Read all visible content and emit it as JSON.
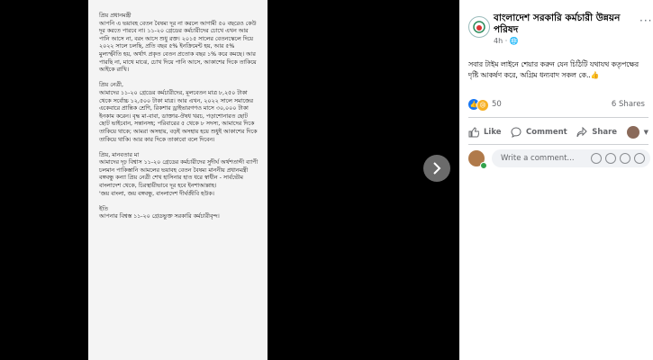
{
  "photo": {
    "text": "প্রিয় প্রধানমন্ত্রী\nআপনি এ ভয়াবহ বেতন বৈষম্য দূর না করলে আগামী ৫০ বছরেও কেউ দূর করতে পারবে না। ১১-২০ গ্রেডের কর্মচারীদের চোখে এখন আর পানি আসে না, বরং আসে শুধু রক্ত। ২০১৫ সালের বেতনস্কেলে দিয়ে ২০২২ সালে চলছি, প্রতি বছর ৫% ইনক্রিমেন্ট হয়, আর ৫% মুল্যস্ফীতি হয়, অর্থাৎ প্রকৃত বেতন প্রতোক বছর ১% করে কমছে। আর পারছি না, মাথে মাঝে, চোখ দিয়ে পানি আসে, আকাশের দিকে তাকিয়ে আইকে রাখি।\n\nপ্রিয় নেত্রী,\nআমাদের ১১-২০ গ্রেডের কর্মচারীদের, মূলবেতন মাত্র ৮,২৫০ টাকা থেকে সর্বোচ্চ ১২,৫০০ টাকা মাত্র। আর এখন, ২০২২ সালে সমাজের একেবারে প্রান্তিক শ্রেণি, রিকশার ড্রাইভারগণও মাসে ৩০,০০০ টাকা ইনকাম করেন। বৃদ্ধ মা-বাবা, ডাক্তার-ঔষধ খরচ, পড়াশোনারত ছোট ছোট ভাইবোন, সন্তানসহ; পরিবারের ৫ থেকে ৮ সদস্য, আমাদের দিকে তাকিয়ে থাকে; আমরা অসহায়, বড়ই অসহায় হয়ে শুধুই আকাশের দিকে তাকিয়ে থাকি। আর কার দিকে তাকাবো বলে দিবেন।\n\nপ্রিয়, মানবতার মা\nআমাদের দৃঢ় বিশ্বাস ১১-২০ গ্রেডের কর্মচারীদের সুদীর্ঘ অর্থশতাব্দী ব্যাপী চলমান পাকিস্তানি আমলের ভয়াবহ বেতন বৈষম্য মাননীয় প্রধানমন্ত্রী বঙ্গবন্ধু কন্যা প্রিয় নেত্রী শেখ হাসিনার হাত ধরে স্বাধীন - সার্বভৌম বাংলাদেশ থেকে, চিরস্থায়ীভাবে দূর হবে ইনশাআল্লাহ।\n'জয় বাংলা, জয় বঙ্গবন্ধু, বাংলাদেশ দীর্ঘজীবি হউক।\n\nইতি\nআপনার বিশ্বস্ত ১১-২০ গ্রেডভুক্ত সরকারি কর্মচারীবৃন্দ।"
  },
  "post": {
    "page_name": "বাংলাদেশ সরকারি কর্মচারী উন্নয়ন পরিষদ",
    "time": "4h",
    "caption": "সবার টাইম লাইনে শেয়ার করুন যেন চিঠিটি যথাযথ কতৃপক্ষের দৃষ্টি আকর্ষণ করে, অগ্রিম ধন্যবাদ সকল কে..👍",
    "reaction_count": "50",
    "shares": "6 Shares"
  },
  "actions": {
    "like": "Like",
    "comment": "Comment",
    "share": "Share"
  },
  "comment_box": {
    "placeholder": "Write a comment..."
  },
  "colors": {
    "like_blue": "#1877f2",
    "online_green": "#31a24c"
  },
  "icons": [
    "chevron-right-icon",
    "like-icon",
    "sad-icon",
    "comment-icon",
    "share-icon",
    "more-icon"
  ]
}
